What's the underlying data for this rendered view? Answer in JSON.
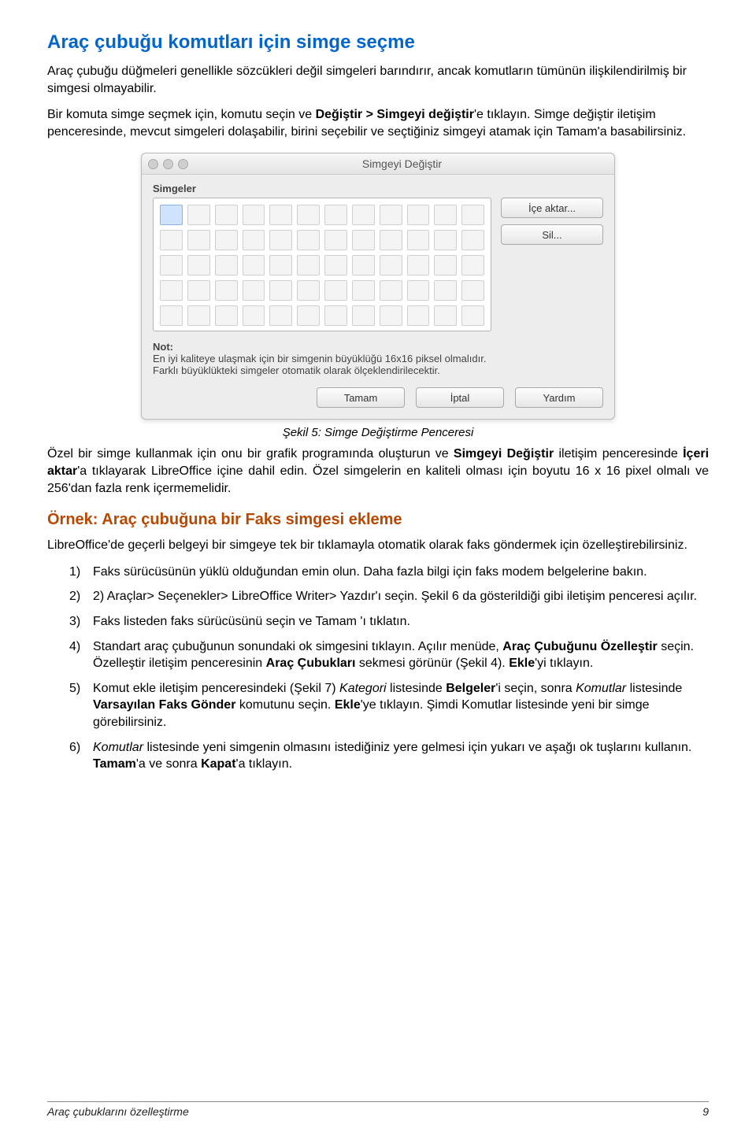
{
  "section_heading": "Araç çubuğu komutları için simge seçme",
  "p1": "Araç çubuğu düğmeleri genellikle sözcükleri değil simgeleri barındırır, ancak komutların tümünün ilişkilendirilmiş bir simgesi olmayabilir.",
  "p2_a": "Bir komuta simge seçmek için, komutu seçin ve ",
  "p2_b": "Değiştir > Simgeyi değiştir",
  "p2_c": "'e tıklayın. Simge değiştir iletişim penceresinde, mevcut simgeleri dolaşabilir, birini seçebilir ve seçtiğiniz simgeyi atamak için Tamam'a basabilirsiniz.",
  "dialog": {
    "title": "Simgeyi Değiştir",
    "icons_label": "Simgeler",
    "import_btn": "İçe aktar...",
    "delete_btn": "Sil...",
    "note_label": "Not:",
    "note_line1": "En iyi kaliteye ulaşmak için bir simgenin büyüklüğü 16x16 piksel olmalıdır.",
    "note_line2": "Farklı büyüklükteki simgeler otomatik olarak ölçeklendirilecektir.",
    "ok_btn": "Tamam",
    "cancel_btn": "İptal",
    "help_btn": "Yardım"
  },
  "caption": "Şekil 5: Simge Değiştirme Penceresi",
  "p3_a": "Özel bir simge kullanmak için onu bir grafik programında oluşturun ve ",
  "p3_b": "Simgeyi Değiştir",
  "p3_c": " iletişim penceresinde ",
  "p3_d": "İçeri aktar",
  "p3_e": "'a tıklayarak LibreOffice içine dahil edin. Özel simgelerin en kaliteli olması için boyutu 16 x 16 pixel olmalı ve 256'dan fazla renk içermemelidir.",
  "subsection_heading": "Örnek: Araç çubuğuna bir Faks simgesi ekleme",
  "p4": "LibreOffice'de geçerli belgeyi bir simgeye tek bir tıklamayla otomatik olarak  faks göndermek için özelleştirebilirsiniz.",
  "list": {
    "i1": {
      "num": "1)",
      "text": "Faks sürücüsünün yüklü olduğundan emin olun. Daha fazla bilgi için faks modem belgelerine bakın."
    },
    "i2": {
      "num": "2)",
      "text": "2) Araçlar> Seçenekler> LibreOffice Writer> Yazdır'ı seçin. Şekil 6 da gösterildiği gibi iletişim penceresi açılır."
    },
    "i3": {
      "num": "3)",
      "text": "Faks listeden faks sürücüsünü seçin ve Tamam 'ı tıklatın."
    },
    "i4": {
      "num": "4)",
      "a": "Standart araç çubuğunun sonundaki ok simgesini tıklayın. Açılır menüde, ",
      "b": "Araç Çubuğunu Özelleştir",
      "c": " seçin. Özelleştir iletişim penceresinin ",
      "d": "Araç Çubukları",
      "e": " sekmesi görünür (Şekil 4). ",
      "f": "Ekle",
      "g": "'yi tıklayın."
    },
    "i5": {
      "num": "5)",
      "a": "Komut ekle iletişim penceresindeki (Şekil 7) ",
      "b": "Kategori",
      "c": " listesinde ",
      "d": "Belgeler",
      "e": "'i seçin, sonra ",
      "f": "Komutlar",
      "g": " listesinde ",
      "h": "Varsayılan Faks Gönder",
      "i": " komutunu seçin. ",
      "j": "Ekle",
      "k": "'ye tıklayın. Şimdi Komutlar listesinde yeni bir simge görebilirsiniz."
    },
    "i6": {
      "num": "6)",
      "a": "Komutlar",
      "b": " listesinde yeni simgenin olmasını istediğiniz yere gelmesi için yukarı ve aşağı ok tuşlarını kullanın. ",
      "c": "Tamam",
      "d": "'a ve sonra ",
      "e": "Kapat",
      "f": "'a tıklayın."
    }
  },
  "footer_left": "Araç çubuklarını özelleştirme",
  "footer_right": "9"
}
